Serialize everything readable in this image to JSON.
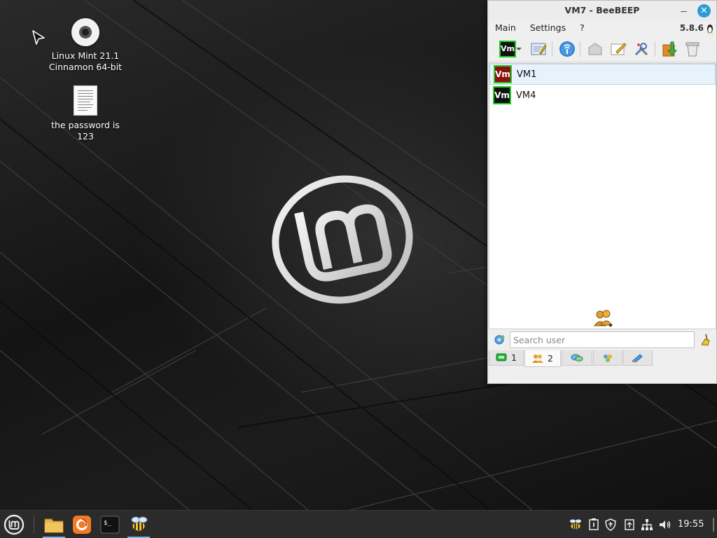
{
  "desktop": {
    "icons": [
      {
        "label": "Linux Mint 21.1 Cinnamon 64-bit",
        "icon": "disc-icon"
      },
      {
        "label": "the password is 123",
        "icon": "text-file-icon"
      }
    ]
  },
  "beebeep": {
    "title": "VM7 - BeeBEEP",
    "menu": [
      "Main",
      "Settings",
      "?"
    ],
    "version": "5.8.6",
    "toolbar_icons": [
      "status-icon",
      "edit-profile-icon",
      "network-icon",
      "mail-icon",
      "compose-icon",
      "tools-icon",
      "download-icon",
      "trash-icon"
    ],
    "current_user_badge": "Vm",
    "users": [
      {
        "badge": "Vm",
        "name": "VM1",
        "selected": true,
        "color": "#8b1010"
      },
      {
        "badge": "Vm",
        "name": "VM4",
        "selected": false,
        "color": "#111111"
      }
    ],
    "search": {
      "placeholder": "Search user"
    },
    "tabs": [
      {
        "icon": "chat-icon",
        "count": "1",
        "active": false
      },
      {
        "icon": "users-icon",
        "count": "2",
        "active": true
      },
      {
        "icon": "messages-icon",
        "count": "",
        "active": false
      },
      {
        "icon": "groups-icon",
        "count": "",
        "active": false
      },
      {
        "icon": "files-icon",
        "count": "",
        "active": false
      }
    ],
    "accent_color": "#2d9bd8",
    "online_color": "#1ecf1e"
  },
  "taskbar": {
    "launchers": [
      "mint-menu-icon",
      "files-icon",
      "firefox-icon",
      "terminal-icon",
      "beebeep-icon"
    ],
    "tray": [
      "beebeep-tray-icon",
      "updates-icon",
      "shield-icon",
      "clipboard-icon",
      "network-icon",
      "volume-icon"
    ],
    "clock": "19:55"
  }
}
